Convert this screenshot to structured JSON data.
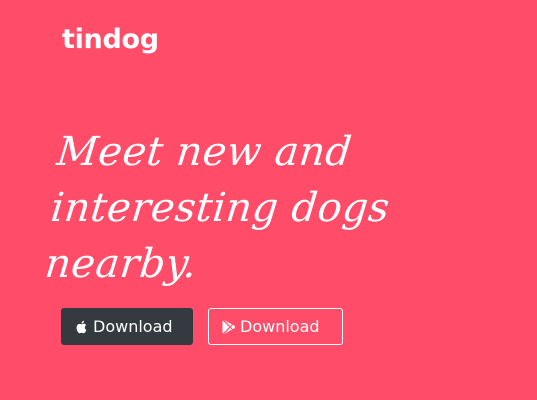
{
  "navbar": {
    "brand": "tindog"
  },
  "hero": {
    "headline_lines": [
      "Meet new and",
      "interesting dogs",
      "nearby."
    ]
  },
  "buttons": {
    "apple": {
      "label": "Download",
      "icon": "apple-icon"
    },
    "google_play": {
      "label": "Download",
      "icon": "google-play-icon"
    }
  },
  "colors": {
    "background": "#ff4c68",
    "dark_button": "#343a40",
    "text": "#ffffff"
  }
}
